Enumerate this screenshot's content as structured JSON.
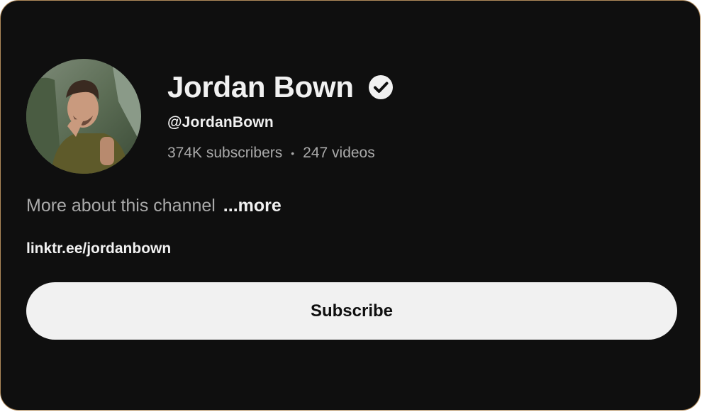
{
  "channel": {
    "name": "Jordan Bown",
    "handle": "@JordanBown",
    "subscribers": "374K subscribers",
    "separator": "•",
    "videos": "247 videos",
    "about_text": "More about this channel",
    "more_label": "...more",
    "link": "linktr.ee/jordanbown",
    "subscribe_label": "Subscribe"
  },
  "icons": {
    "verified": "verified-check-icon",
    "avatar": "channel-avatar"
  },
  "colors": {
    "background": "#0f0f0f",
    "text_primary": "#f1f1f1",
    "text_secondary": "#aaaaaa",
    "button_bg": "#f1f1f1"
  }
}
